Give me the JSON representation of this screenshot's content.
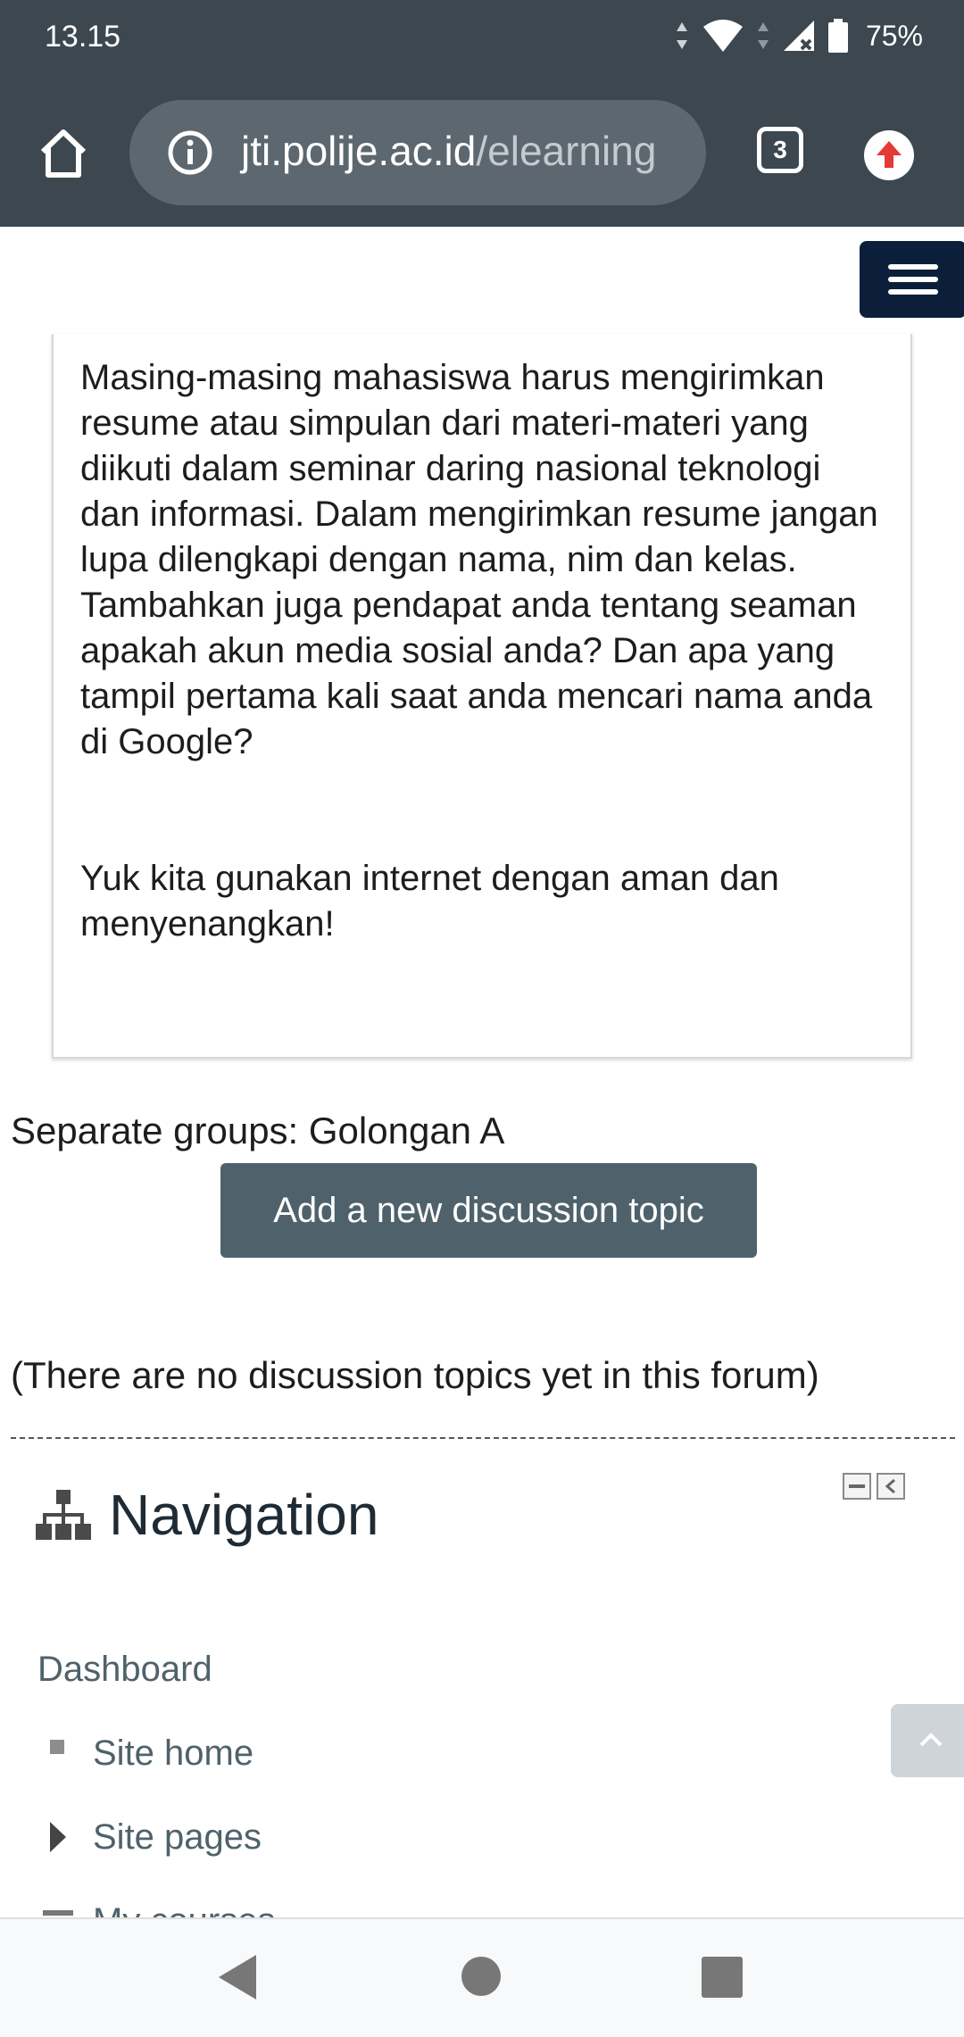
{
  "status_bar": {
    "time": "13.15",
    "battery": "75%"
  },
  "browser": {
    "url_host": "jti.polije.ac.id",
    "url_path": "/elearning",
    "tab_count": "3"
  },
  "forum": {
    "description_paragraphs": [
      "Masing-masing mahasiswa harus mengirimkan resume atau simpulan dari materi-materi yang diikuti dalam seminar daring nasional teknologi dan informasi. Dalam mengirimkan resume jangan lupa dilengkapi dengan nama, nim dan kelas. Tambahkan juga pendapat anda tentang seaman apakah akun media sosial anda? Dan apa yang tampil pertama kali saat anda mencari nama anda di Google?",
      "Yuk kita gunakan internet dengan aman dan menyenangkan!"
    ],
    "groups_label": "Separate groups: Golongan A",
    "add_topic_label": "Add a new discussion topic",
    "no_topics_text": "(There are no discussion topics yet in this forum)"
  },
  "navigation": {
    "title": "Navigation",
    "items": [
      {
        "label": "Dashboard"
      },
      {
        "label": "Site home"
      },
      {
        "label": "Site pages"
      },
      {
        "label": "My courses"
      }
    ]
  },
  "icons": [
    "home-icon",
    "info-icon",
    "tabs-icon",
    "update-icon",
    "menu-icon",
    "sitemap-icon",
    "collapse-icon",
    "dock-icon",
    "chevron-up-icon",
    "back-icon",
    "home-nav-icon",
    "recents-icon"
  ]
}
